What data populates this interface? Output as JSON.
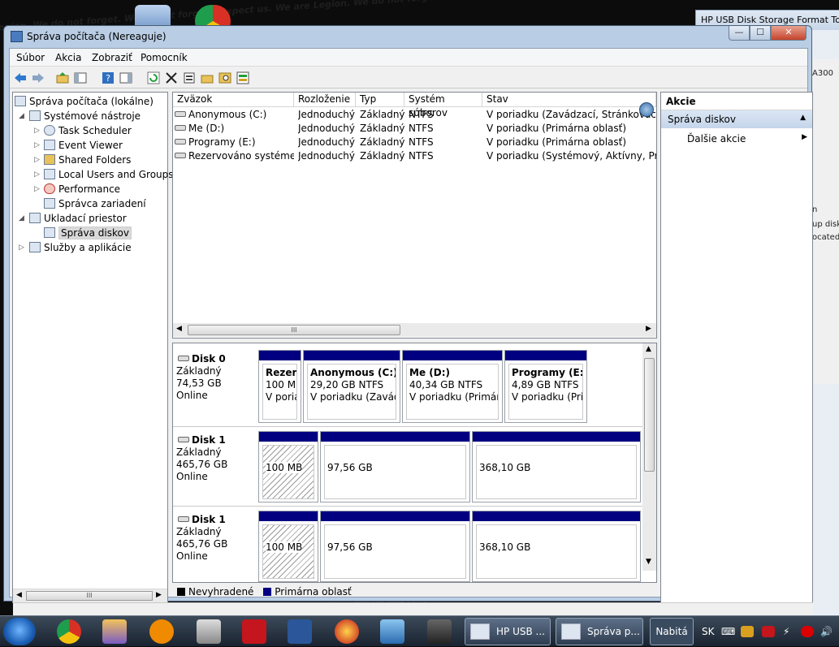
{
  "window": {
    "title": "Správa počítača (Nereaguje)",
    "btn_min": "—",
    "btn_max": "☐",
    "btn_close": "✕"
  },
  "background_window": {
    "title": "HP USB Disk Storage Format Tool",
    "fragments": [
      "A300",
      "n",
      "up disk",
      "ocated"
    ]
  },
  "wallpaper_text": "Legion. We do not forget. We do not forgive. Expect us. We are Legion. We do not forget. We do not forgive. Expect us.",
  "menu": [
    "Súbor",
    "Akcia",
    "Zobraziť",
    "Pomocník"
  ],
  "tree": {
    "root": "Správa počítača (lokálne)",
    "items": [
      {
        "label": "Systémové nástroje",
        "icon": "tools-icon"
      },
      {
        "label": "Task Scheduler",
        "icon": "clock-icon"
      },
      {
        "label": "Event Viewer",
        "icon": "event-viewer-icon"
      },
      {
        "label": "Shared Folders",
        "icon": "shared-folder-icon"
      },
      {
        "label": "Local Users and Groups",
        "icon": "users-icon"
      },
      {
        "label": "Performance",
        "icon": "performance-icon"
      },
      {
        "label": "Správca zariadení",
        "icon": "device-manager-icon"
      },
      {
        "label": "Ukladací priestor",
        "icon": "storage-icon"
      },
      {
        "label": "Správa diskov",
        "icon": "disk-management-icon"
      },
      {
        "label": "Služby a aplikácie",
        "icon": "services-icon"
      }
    ],
    "scroll_thumb": "III"
  },
  "volumes": {
    "headers": [
      "Zväzok",
      "Rozloženie",
      "Typ",
      "Systém súborov",
      "Stav"
    ],
    "rows": [
      [
        "Anonymous (C:)",
        "Jednoduchý",
        "Základný",
        "NTFS",
        "V poriadku (Zavádzací, Stránkovací súbo"
      ],
      [
        "Me (D:)",
        "Jednoduchý",
        "Základný",
        "NTFS",
        "V poriadku (Primárna oblasť)"
      ],
      [
        "Programy (E:)",
        "Jednoduchý",
        "Základný",
        "NTFS",
        "V poriadku (Primárna oblasť)"
      ],
      [
        "Rezervováno systémem",
        "Jednoduchý",
        "Základný",
        "NTFS",
        "V poriadku (Systémový, Aktívny, Primár"
      ]
    ],
    "scroll_thumb": "III"
  },
  "disks": [
    {
      "name": "Disk 0",
      "type": "Základný",
      "size": "74,53 GB",
      "status": "Online",
      "partitions": [
        {
          "title": "Rezerv",
          "line1": "100 MB",
          "line2": "V poria"
        },
        {
          "title": "Anonymous  (C:)",
          "line1": "29,20 GB NTFS",
          "line2": "V poriadku (Zavádza"
        },
        {
          "title": "Me  (D:)",
          "line1": "40,34 GB NTFS",
          "line2": "V poriadku (Primárna"
        },
        {
          "title": "Programy  (E:)",
          "line1": "4,89 GB NTFS",
          "line2": "V poriadku (Prim"
        }
      ]
    },
    {
      "name": "Disk 1",
      "type": "Základný",
      "size": "465,76 GB",
      "status": "Online",
      "partitions": [
        {
          "line1": "100 MB"
        },
        {
          "line1": "97,56 GB"
        },
        {
          "line1": "368,10 GB"
        }
      ]
    },
    {
      "name": "Disk 1",
      "type": "Základný",
      "size": "465,76 GB",
      "status": "Online",
      "partitions": [
        {
          "line1": "100 MB"
        },
        {
          "line1": "97,56 GB"
        },
        {
          "line1": "368,10 GB"
        }
      ]
    }
  ],
  "legend": {
    "unallocated": "Nevyhradené",
    "primary": "Primárna oblasť",
    "unallocated_color": "#000000",
    "primary_color": "#000080"
  },
  "actions": {
    "header": "Akcie",
    "section": "Správa diskov",
    "item": "Ďalšie akcie"
  },
  "taskbar": {
    "tasks": [
      "HP USB ...",
      "Správa p..."
    ],
    "battery": "Nabitá",
    "lang": "SK"
  }
}
